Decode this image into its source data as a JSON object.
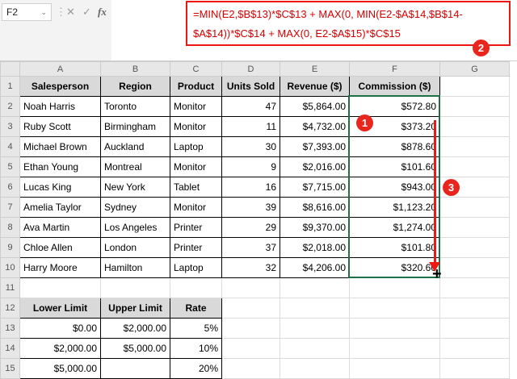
{
  "colors": {
    "selection_green": "#1E7145",
    "annotation_red": "#E8261E",
    "formula_red": "#D40000",
    "header_fill": "#D9D9D9"
  },
  "formula_bar": {
    "name_box": "F2",
    "chevron_glyph": "⌄",
    "dots_glyph": "⋮",
    "cancel_glyph": "✕",
    "check_glyph": "✓",
    "fx_label": "fx",
    "line1": "=MIN(E2,$B$13)*$C$13 + MAX(0, MIN(E2-$A$14,$B$14-",
    "line2": "$A$14))*$C$14 + MAX(0, E2-$A$15)*$C$15"
  },
  "badges": {
    "one": "1",
    "two": "2",
    "three": "3"
  },
  "fill_handle_glyph": "+",
  "grid": {
    "column_letters": [
      "A",
      "B",
      "C",
      "D",
      "E",
      "F",
      "G"
    ],
    "row_numbers": [
      "1",
      "2",
      "3",
      "4",
      "5",
      "6",
      "7",
      "8",
      "9",
      "10",
      "11",
      "12",
      "13",
      "14",
      "15"
    ]
  },
  "sales_table": {
    "headers": [
      "Salesperson",
      "Region",
      "Product",
      "Units Sold",
      "Revenue ($)",
      "Commission ($)"
    ],
    "rows": [
      [
        "Noah Harris",
        "Toronto",
        "Monitor",
        "47",
        "$5,864.00",
        "$572.80"
      ],
      [
        "Ruby Scott",
        "Birmingham",
        "Monitor",
        "11",
        "$4,732.00",
        "$373.20"
      ],
      [
        "Michael Brown",
        "Auckland",
        "Laptop",
        "30",
        "$7,393.00",
        "$878.60"
      ],
      [
        "Ethan Young",
        "Montreal",
        "Monitor",
        "9",
        "$2,016.00",
        "$101.60"
      ],
      [
        "Lucas King",
        "New York",
        "Tablet",
        "16",
        "$7,715.00",
        "$943.00"
      ],
      [
        "Amelia Taylor",
        "Sydney",
        "Monitor",
        "39",
        "$8,616.00",
        "$1,123.20"
      ],
      [
        "Ava Martin",
        "Los Angeles",
        "Printer",
        "29",
        "$9,370.00",
        "$1,274.00"
      ],
      [
        "Chloe Allen",
        "London",
        "Printer",
        "37",
        "$2,018.00",
        "$101.80"
      ],
      [
        "Harry Moore",
        "Hamilton",
        "Laptop",
        "32",
        "$4,206.00",
        "$320.60"
      ]
    ]
  },
  "limits_table": {
    "headers": [
      "Lower Limit",
      "Upper Limit",
      "Rate"
    ],
    "rows": [
      [
        "$0.00",
        "$2,000.00",
        "5%"
      ],
      [
        "$2,000.00",
        "$5,000.00",
        "10%"
      ],
      [
        "$5,000.00",
        "",
        "20%"
      ]
    ]
  }
}
